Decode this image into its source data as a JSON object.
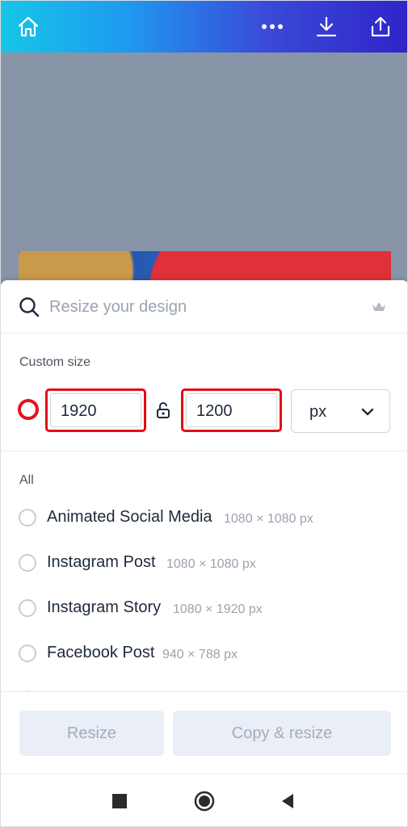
{
  "topbar": {
    "icons": [
      "home-icon",
      "more-icon",
      "download-icon",
      "share-icon"
    ]
  },
  "resize_panel": {
    "search_placeholder": "Resize your design",
    "custom_size_label": "Custom size",
    "width_value": "1920",
    "height_value": "1200",
    "unit_value": "px",
    "all_label": "All",
    "presets": [
      {
        "name": "Animated Social Media",
        "dims": "1080 × 1080 px"
      },
      {
        "name": "Instagram Post",
        "dims": "1080 × 1080 px"
      },
      {
        "name": "Instagram Story",
        "dims": "1080 × 1920 px"
      },
      {
        "name": "Facebook Post",
        "dims": "940 × 788 px"
      }
    ],
    "resize_button": "Resize",
    "copy_resize_button": "Copy & resize"
  },
  "colors": {
    "highlight": "#e30b18",
    "topbar_start": "#16c6e6",
    "topbar_end": "#2f24c9",
    "button_disabled_bg": "#eaeef6",
    "button_disabled_text": "#a3adbd"
  }
}
